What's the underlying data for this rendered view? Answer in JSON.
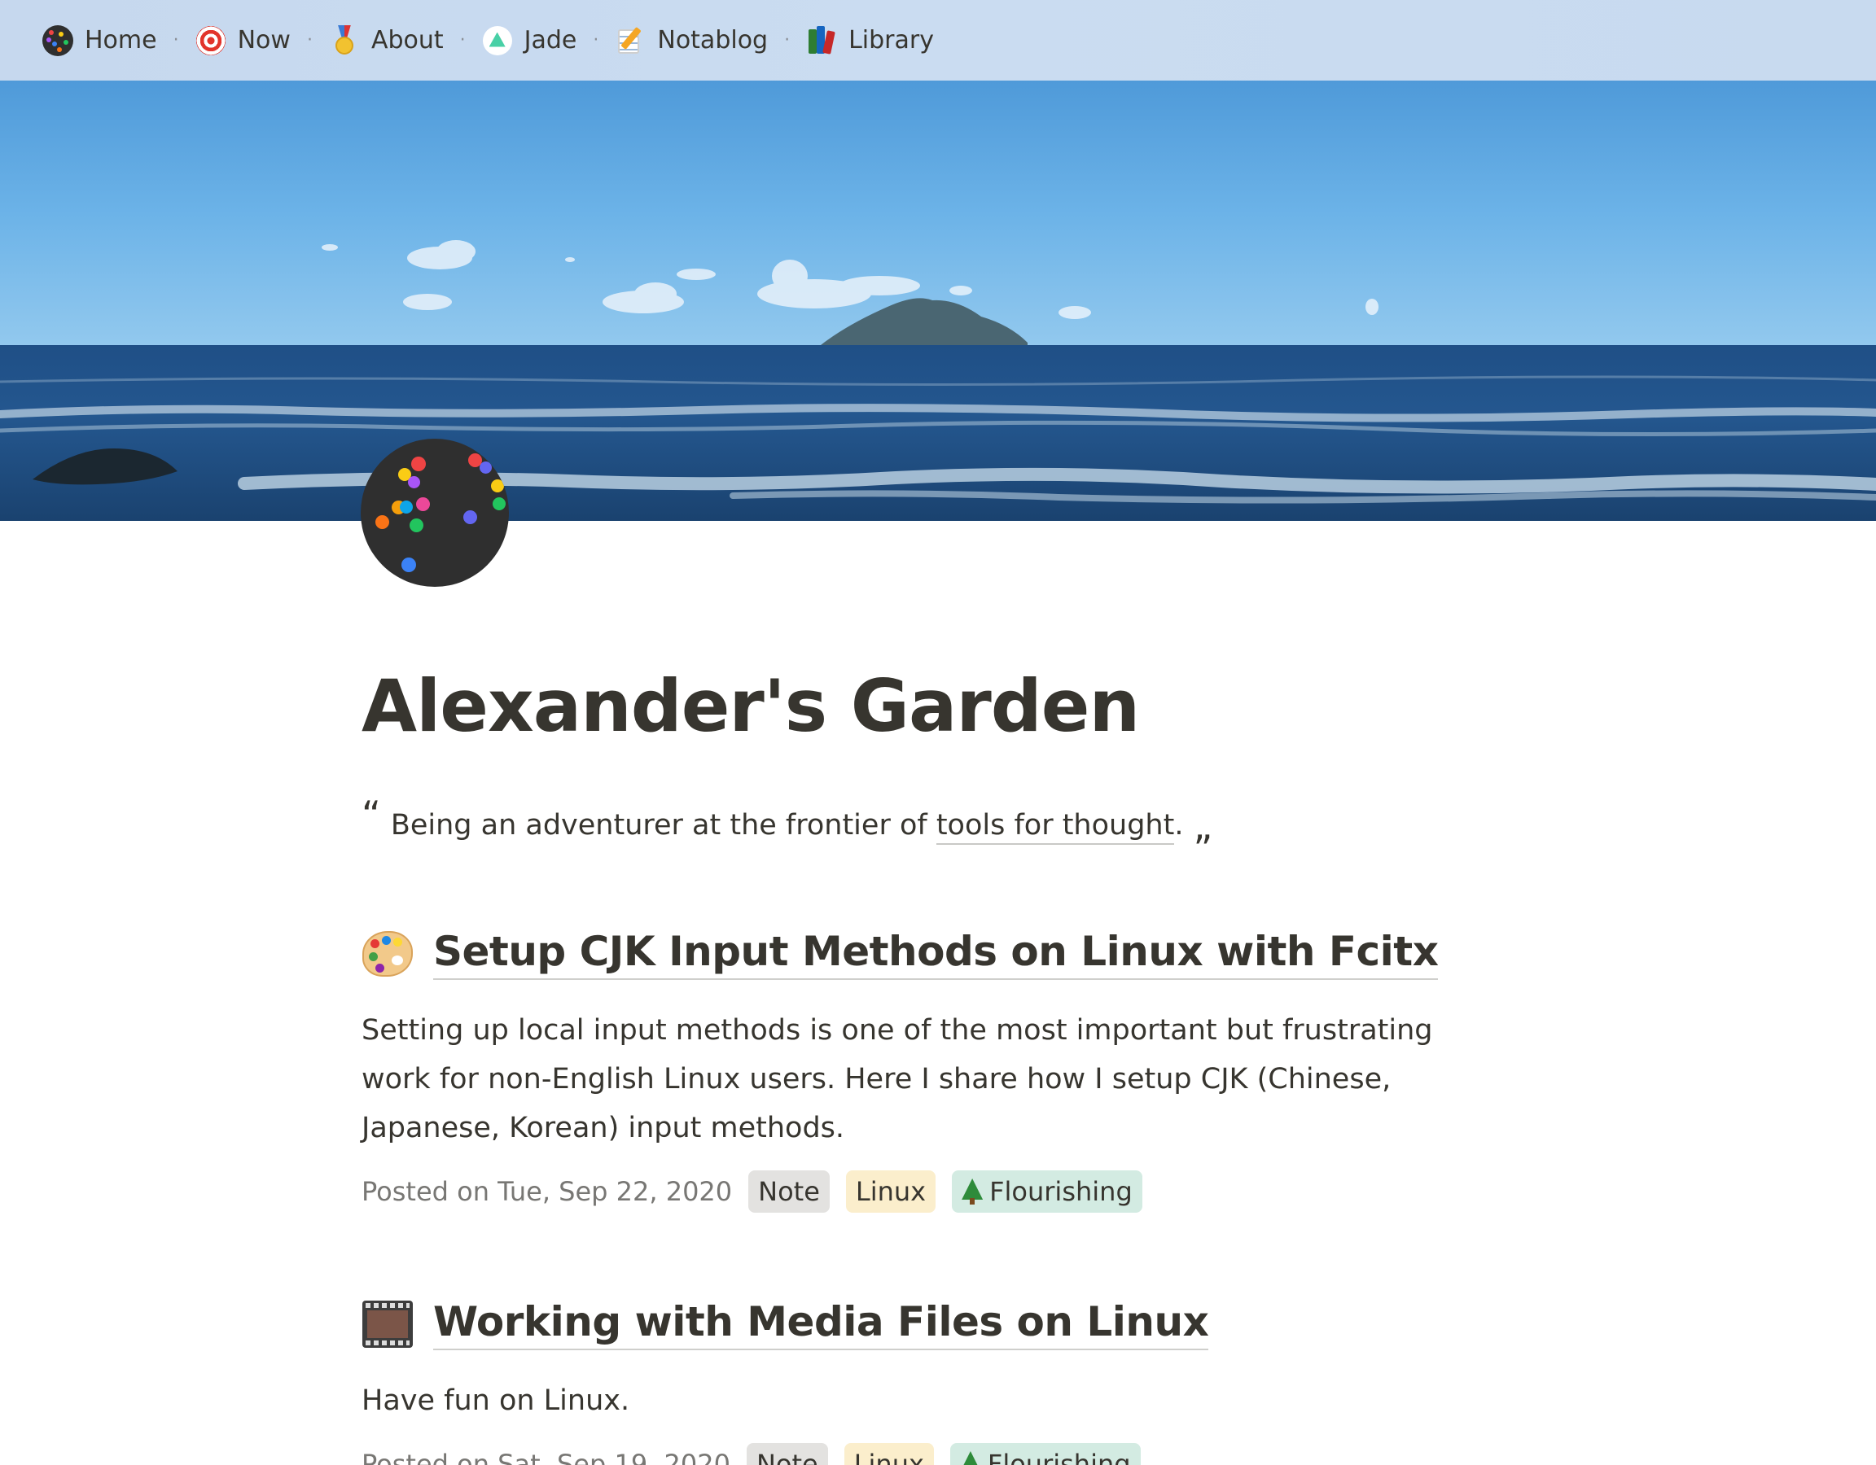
{
  "nav": {
    "items": [
      {
        "label": "Home",
        "icon": "site-logo-icon"
      },
      {
        "label": "Now",
        "icon": "target-icon"
      },
      {
        "label": "About",
        "icon": "medal-icon"
      },
      {
        "label": "Jade",
        "icon": "jade-icon"
      },
      {
        "label": "Notablog",
        "icon": "memo-icon"
      },
      {
        "label": "Library",
        "icon": "books-icon"
      }
    ],
    "separator": "·"
  },
  "page": {
    "title": "Alexander's Garden",
    "quote_open": "“",
    "quote_text": "Being an adventurer at the frontier of ",
    "quote_link": "tools for thought",
    "quote_end": ".",
    "quote_close": "„"
  },
  "posts": [
    {
      "icon": "palette-icon",
      "title": "Setup CJK Input Methods on Linux with Fcitx",
      "description": "Setting up local input methods is one of the most important but frustrating work for non-English Linux users. Here I share how I setup CJK (Chinese, Japanese, Korean) input methods.",
      "posted": "Posted on Tue, Sep 22, 2020",
      "tags": [
        "Note",
        "Linux",
        "Flourishing"
      ]
    },
    {
      "icon": "film-frames-icon",
      "title": "Working with Media Files on Linux",
      "description": "Have fun on Linux.",
      "posted": "Posted on Sat, Sep 19, 2020",
      "tags": [
        "Note",
        "Linux",
        "Flourishing"
      ]
    }
  ],
  "colors": {
    "nav_background": "#c8daef",
    "text": "#37352f",
    "meta_text": "#787774",
    "tag_note": "#e3e2e0",
    "tag_linux": "#fbeecc",
    "tag_flourishing": "#d3ebe2"
  }
}
